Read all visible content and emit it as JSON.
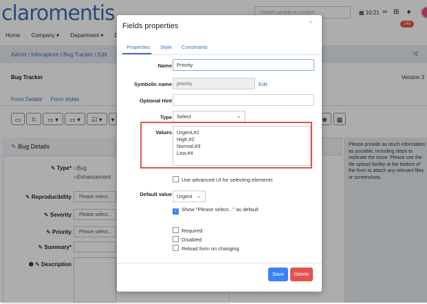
{
  "app": {
    "logo": "claromentis",
    "nav": [
      "Home",
      "Company ▾",
      "Department ▾",
      "D"
    ],
    "search_placeholder": "Search people or content",
    "time": "10:21",
    "notification_count": "148",
    "breadcrumb": "Admin / Infocapture / Bug Tracker / Edit",
    "page_title": "Bug Tracker",
    "version": "Version 3",
    "form_tabs": [
      "Form Details",
      "Form styles"
    ]
  },
  "form": {
    "section_title": "Bug Details",
    "type_label": "Type*",
    "type_options": [
      "Bug",
      "Enhancement"
    ],
    "reproducibility_label": "Reproducibility",
    "severity_label": "Severity",
    "priority_label": "Priority",
    "summary_label": "Summary*",
    "description_label": "Description",
    "select_placeholder": "Please select...",
    "hint_text": "Please provide as much information as possible, including steps to replicate the issue. Please use the file upload facility at the bottom of the form to attach any relevant files or screenshots."
  },
  "modal": {
    "title": "Fields properties",
    "close": "×",
    "tabs": [
      "Properties",
      "Style",
      "Constraints"
    ],
    "name_label": "Name",
    "name_value": "Priority",
    "symbolic_label": "Symbolic name",
    "symbolic_value": "priority",
    "edit_link": "Edit",
    "hint_label": "Optional Hint",
    "hint_value": "",
    "type_label": "Type",
    "type_value": "Select",
    "values_label": "Values",
    "values_lines": [
      "Urgent,#1",
      "High,#2",
      "Normal,#3",
      "Low,#4"
    ],
    "advanced_ui_label": "Use advanced UI for selecting elements",
    "default_label": "Default value",
    "default_value": "Urgent",
    "show_please_select_label": "Show \"Please select...\" as default",
    "required_label": "Required",
    "disabled_label": "Disabled",
    "reload_label": "Reload form on changing",
    "save_label": "Save",
    "delete_label": "Delete"
  },
  "colors": {
    "accent": "#3b6fb6",
    "save": "#3b82f6",
    "delete": "#e0544a",
    "highlight": "#e0544a"
  }
}
